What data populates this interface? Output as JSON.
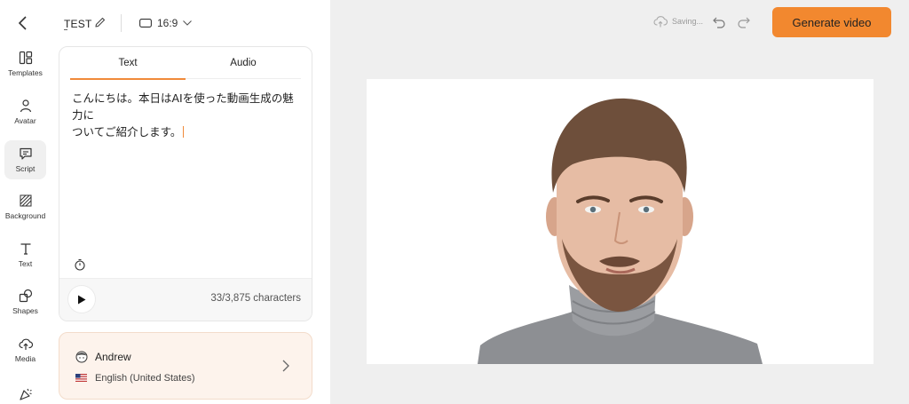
{
  "project": {
    "name": "TEST",
    "aspect_ratio": "16:9"
  },
  "sidebar": {
    "items": [
      {
        "label": "Templates",
        "icon": "templates-icon"
      },
      {
        "label": "Avatar",
        "icon": "avatar-icon"
      },
      {
        "label": "Script",
        "icon": "script-icon",
        "active": true
      },
      {
        "label": "Background",
        "icon": "background-icon"
      },
      {
        "label": "Text",
        "icon": "text-icon"
      },
      {
        "label": "Shapes",
        "icon": "shapes-icon"
      },
      {
        "label": "Media",
        "icon": "media-icon"
      },
      {
        "label": "",
        "icon": "effects-icon"
      }
    ]
  },
  "script": {
    "tabs": [
      "Text",
      "Audio"
    ],
    "active_tab": "Text",
    "content_line1": "こんにちは。本日はAIを使った動画生成の魅力に",
    "content_line2": "ついてご紹介します。",
    "char_count": "33/3,875 characters"
  },
  "voice": {
    "name": "Andrew",
    "language": "English (United States)"
  },
  "toolbar": {
    "saving_label": "Saving...",
    "generate_label": "Generate video"
  },
  "colors": {
    "accent": "#f2882f",
    "canvas_bg": "#efefef",
    "voice_card_bg": "#fdf3ec"
  }
}
